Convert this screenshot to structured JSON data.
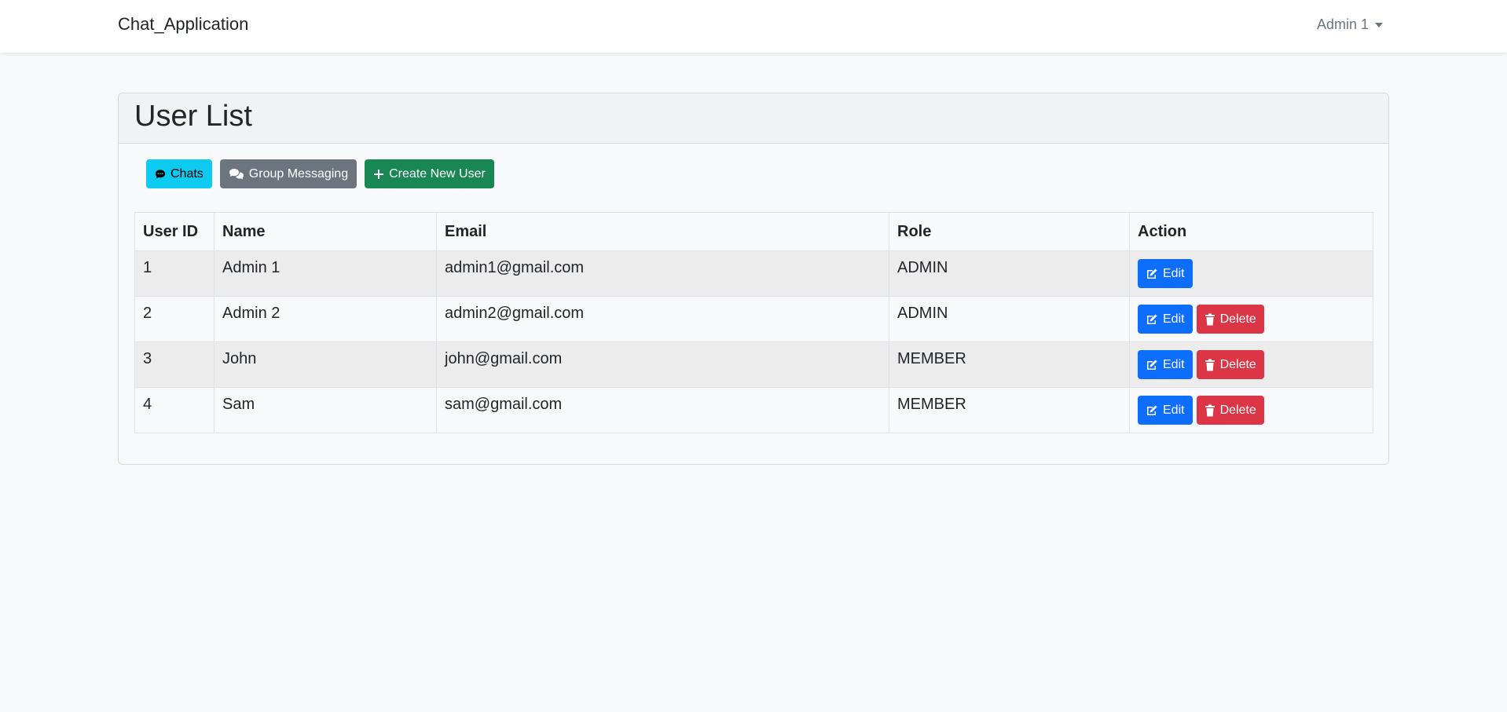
{
  "navbar": {
    "brand": "Chat_Application",
    "user_menu_label": "Admin 1"
  },
  "card": {
    "title": "User List"
  },
  "toolbar": {
    "chats_label": "Chats",
    "group_messaging_label": "Group Messaging",
    "create_user_label": "Create New User"
  },
  "table": {
    "headers": [
      "User ID",
      "Name",
      "Email",
      "Role",
      "Action"
    ],
    "rows": [
      {
        "id": "1",
        "name": "Admin 1",
        "email": "admin1@gmail.com",
        "role": "ADMIN",
        "edit_label": "Edit",
        "delete_label": ""
      },
      {
        "id": "2",
        "name": "Admin 2",
        "email": "admin2@gmail.com",
        "role": "ADMIN",
        "edit_label": "Edit",
        "delete_label": "Delete"
      },
      {
        "id": "3",
        "name": "John",
        "email": "john@gmail.com",
        "role": "MEMBER",
        "edit_label": "Edit",
        "delete_label": "Delete"
      },
      {
        "id": "4",
        "name": "Sam",
        "email": "sam@gmail.com",
        "role": "MEMBER",
        "edit_label": "Edit",
        "delete_label": "Delete"
      }
    ]
  },
  "colors": {
    "info": "#0dcaf0",
    "secondary": "#6c757d",
    "success": "#198754",
    "primary": "#0d6efd",
    "danger": "#dc3545"
  },
  "icons": {
    "chats": "comment-icon",
    "group_messaging": "comments-icon",
    "create_user": "plus-icon",
    "edit": "edit-icon",
    "delete": "trash-icon",
    "user_menu": "caret-down-icon"
  }
}
